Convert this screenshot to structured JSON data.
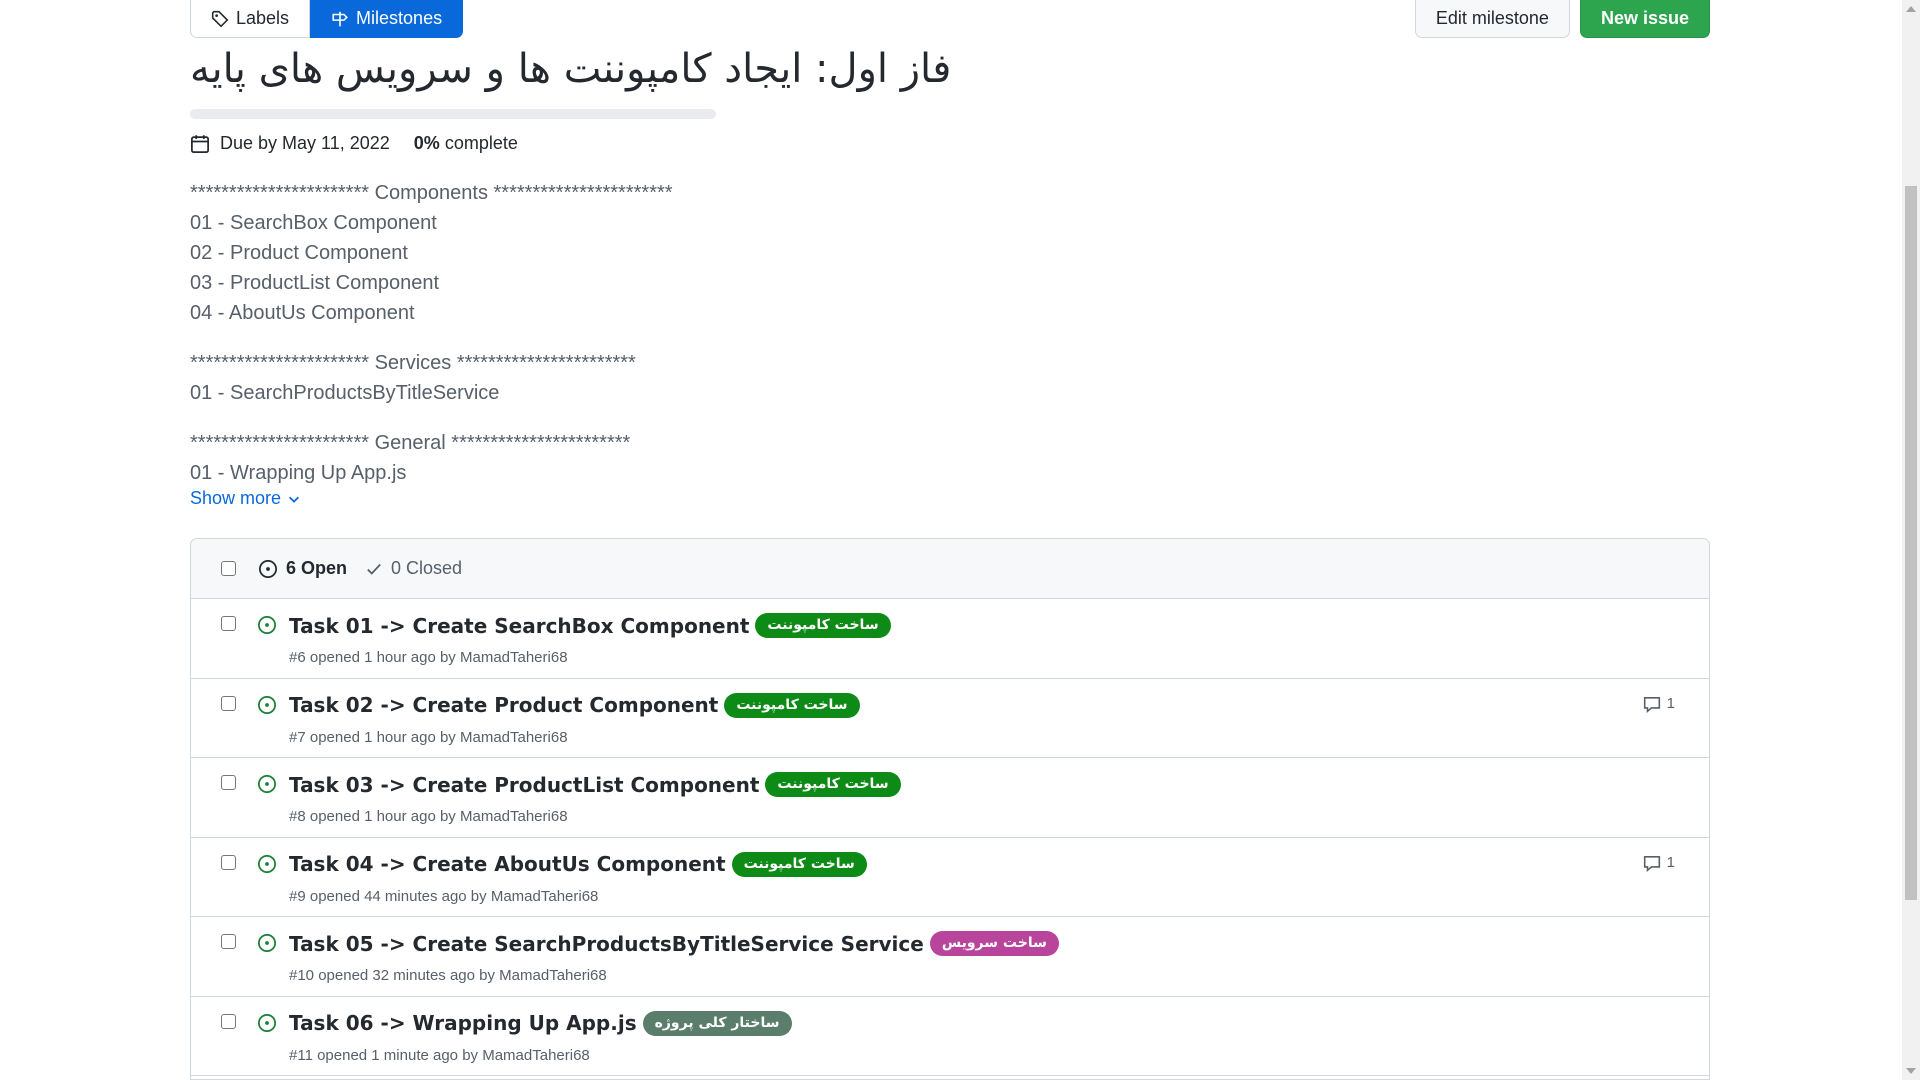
{
  "subnav": {
    "labels": "Labels",
    "milestones": "Milestones"
  },
  "buttons": {
    "edit_milestone": "Edit milestone",
    "new_issue": "New issue"
  },
  "milestone": {
    "title": "فاز اول: ایجاد کامپوننت ها و سرویس های پایه",
    "progress_percent": 0,
    "due": "Due by May 11, 2022",
    "percent": "0%",
    "complete": "complete"
  },
  "description": {
    "components_header": "*********************** Components ***********************",
    "components": [
      "01 - SearchBox Component",
      "02 - Product Component",
      "03 - ProductList Component",
      "04 - AboutUs Component"
    ],
    "services_header": "*********************** Services ***********************",
    "services": [
      "01 - SearchProductsByTitleService"
    ],
    "general_header": "*********************** General ***********************",
    "general": [
      "01 - Wrapping Up App.js"
    ],
    "show_more": "Show more"
  },
  "issues_header": {
    "open": "6 Open",
    "closed": "0 Closed"
  },
  "issues": [
    {
      "title": "Task 01 -> Create SearchBox Component",
      "label": "ساخت کامپوننت",
      "label_color": "#0e8a16",
      "meta": "#6 opened 1 hour ago by",
      "author": "MamadTaheri68",
      "comments": ""
    },
    {
      "title": "Task 02 -> Create Product Component",
      "label": "ساخت کامپوننت",
      "label_color": "#0e8a16",
      "meta": "#7 opened 1 hour ago by",
      "author": "MamadTaheri68",
      "comments": "1"
    },
    {
      "title": "Task 03 -> Create ProductList Component",
      "label": "ساخت کامپوننت",
      "label_color": "#0e8a16",
      "meta": "#8 opened 1 hour ago by",
      "author": "MamadTaheri68",
      "comments": ""
    },
    {
      "title": "Task 04 -> Create AboutUs Component",
      "label": "ساخت کامپوننت",
      "label_color": "#0e8a16",
      "meta": "#9 opened 44 minutes ago by",
      "author": "MamadTaheri68",
      "comments": "1"
    },
    {
      "title": "Task 05 -> Create SearchProductsByTitleService Service",
      "label": "ساخت سرویس",
      "label_color": "#b9449b",
      "meta": "#10 opened 32 minutes ago by",
      "author": "MamadTaheri68",
      "comments": ""
    },
    {
      "title": "Task 06 -> Wrapping Up App.js",
      "label": "ساختار کلی پروژه",
      "label_color": "#5a7d6c",
      "meta": "#11 opened 1 minute ago by",
      "author": "MamadTaheri68",
      "comments": ""
    }
  ],
  "colors": {
    "accent": "#0969da",
    "primary_button": "#2da44e",
    "open_issue": "#1a7f37"
  },
  "icons": {
    "labels": "tag-icon",
    "milestones": "milestone-icon",
    "due": "calendar-icon",
    "open": "issue-opened-icon",
    "closed": "check-icon",
    "comment": "comment-icon",
    "show_more": "chevron-down-icon"
  }
}
